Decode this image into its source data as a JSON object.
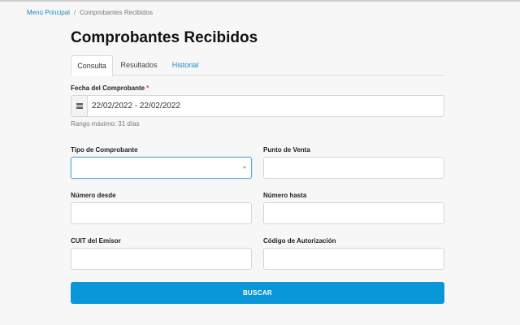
{
  "breadcrumb": {
    "home": "Menú Principal",
    "separator": "/",
    "current": "Comprobantes Recibidos"
  },
  "page": {
    "title": "Comprobantes Recibidos"
  },
  "tabs": [
    {
      "label": "Consulta",
      "active": true
    },
    {
      "label": "Resultados",
      "active": false
    },
    {
      "label": "Historial",
      "active": false
    }
  ],
  "form": {
    "fecha": {
      "label": "Fecha del Comprobante",
      "required_mark": "*",
      "value": "22/02/2022 - 22/02/2022",
      "hint": "Rango máximo: 31 días",
      "icon": "calendar-icon"
    },
    "tipo": {
      "label": "Tipo de Comprobante",
      "value": "",
      "icon": "chevron-down-icon"
    },
    "punto_venta": {
      "label": "Punto de Venta",
      "value": ""
    },
    "numero_desde": {
      "label": "Número desde",
      "value": ""
    },
    "numero_hasta": {
      "label": "Número hasta",
      "value": ""
    },
    "cuit": {
      "label": "CUIT del Emisor",
      "value": ""
    },
    "codigo": {
      "label": "Código de Autorización",
      "value": ""
    },
    "submit_label": "BUSCAR"
  },
  "colors": {
    "accent": "#0a97d9",
    "link": "#1e88c8",
    "required": "#e53935"
  }
}
